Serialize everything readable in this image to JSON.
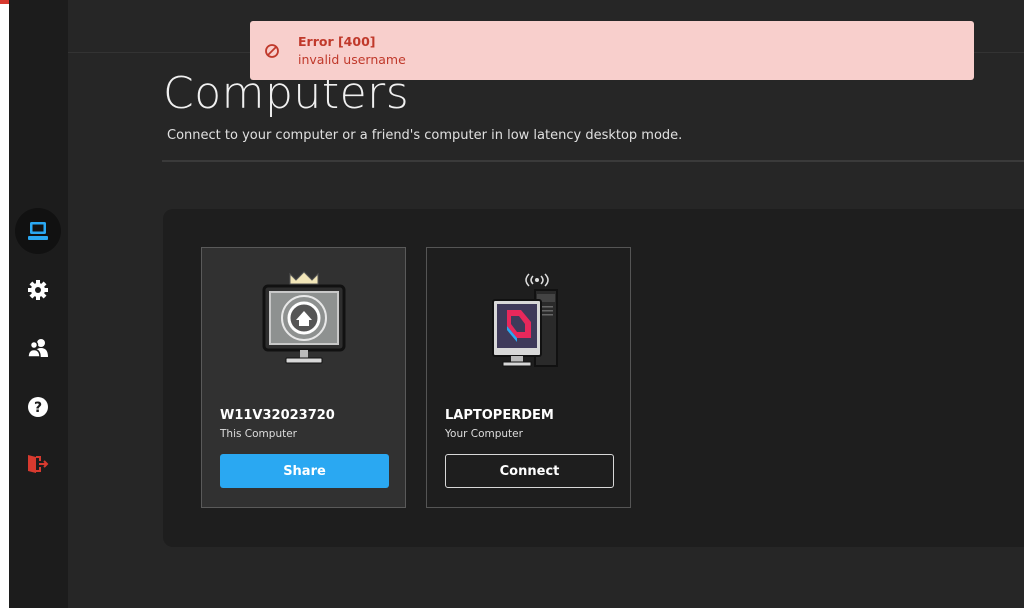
{
  "toast": {
    "title": "Error [400]",
    "message": "invalid username",
    "icon": "prohibited-icon",
    "color": "#c0392b"
  },
  "sidebar": {
    "items": [
      {
        "icon": "computer-icon",
        "active": true
      },
      {
        "icon": "gear-icon"
      },
      {
        "icon": "users-icon"
      },
      {
        "icon": "help-icon"
      },
      {
        "icon": "logout-icon"
      }
    ]
  },
  "page": {
    "title": "Computers",
    "subtitle": "Connect to your computer or a friend's computer in low latency desktop mode."
  },
  "computers": [
    {
      "name": "W11V32023720",
      "subtitle": "This Computer",
      "button": "Share",
      "icon": "home-monitor-icon"
    },
    {
      "name": "LAPTOPERDEM",
      "subtitle": "Your Computer",
      "button": "Connect",
      "icon": "parsec-desktop-icon"
    }
  ],
  "colors": {
    "accent": "#2aa8f2",
    "logout": "#d73a2f"
  }
}
